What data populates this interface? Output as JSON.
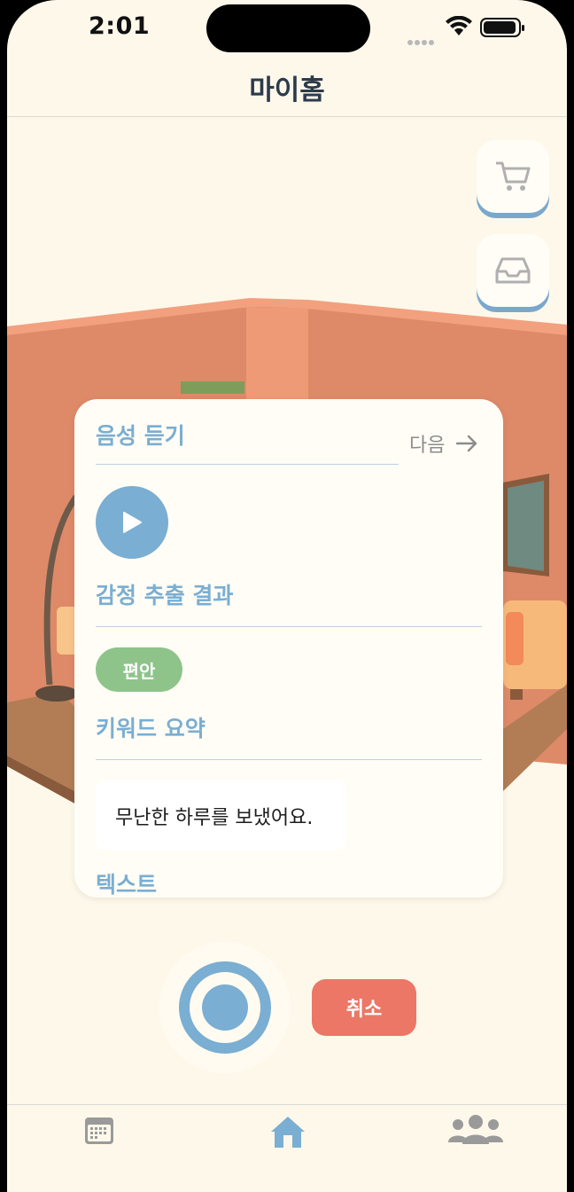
{
  "status_bar": {
    "time": "2:01"
  },
  "header": {
    "title": "마이홈"
  },
  "side_buttons": {
    "shop_icon": "cart-icon",
    "inventory_icon": "tray-icon"
  },
  "card": {
    "voice_title": "음성 듣기",
    "next_label": "다음",
    "emotion_title": "감정 추출 결과",
    "emotion_chip": "편안",
    "keyword_title": "키워드 요약",
    "summary_text": "무난한 하루를 보냈어요.",
    "text_title": "텍스트"
  },
  "controls": {
    "cancel_label": "취소"
  },
  "tabbar": {
    "tabs": [
      "calendar-icon",
      "home-icon",
      "people-icon"
    ],
    "active": "home-icon"
  },
  "colors": {
    "accent": "#7aaed2",
    "emotion_chip": "#8ec48a",
    "cancel": "#ec7767",
    "wall": "#de8a68",
    "background": "#fef8ea"
  }
}
